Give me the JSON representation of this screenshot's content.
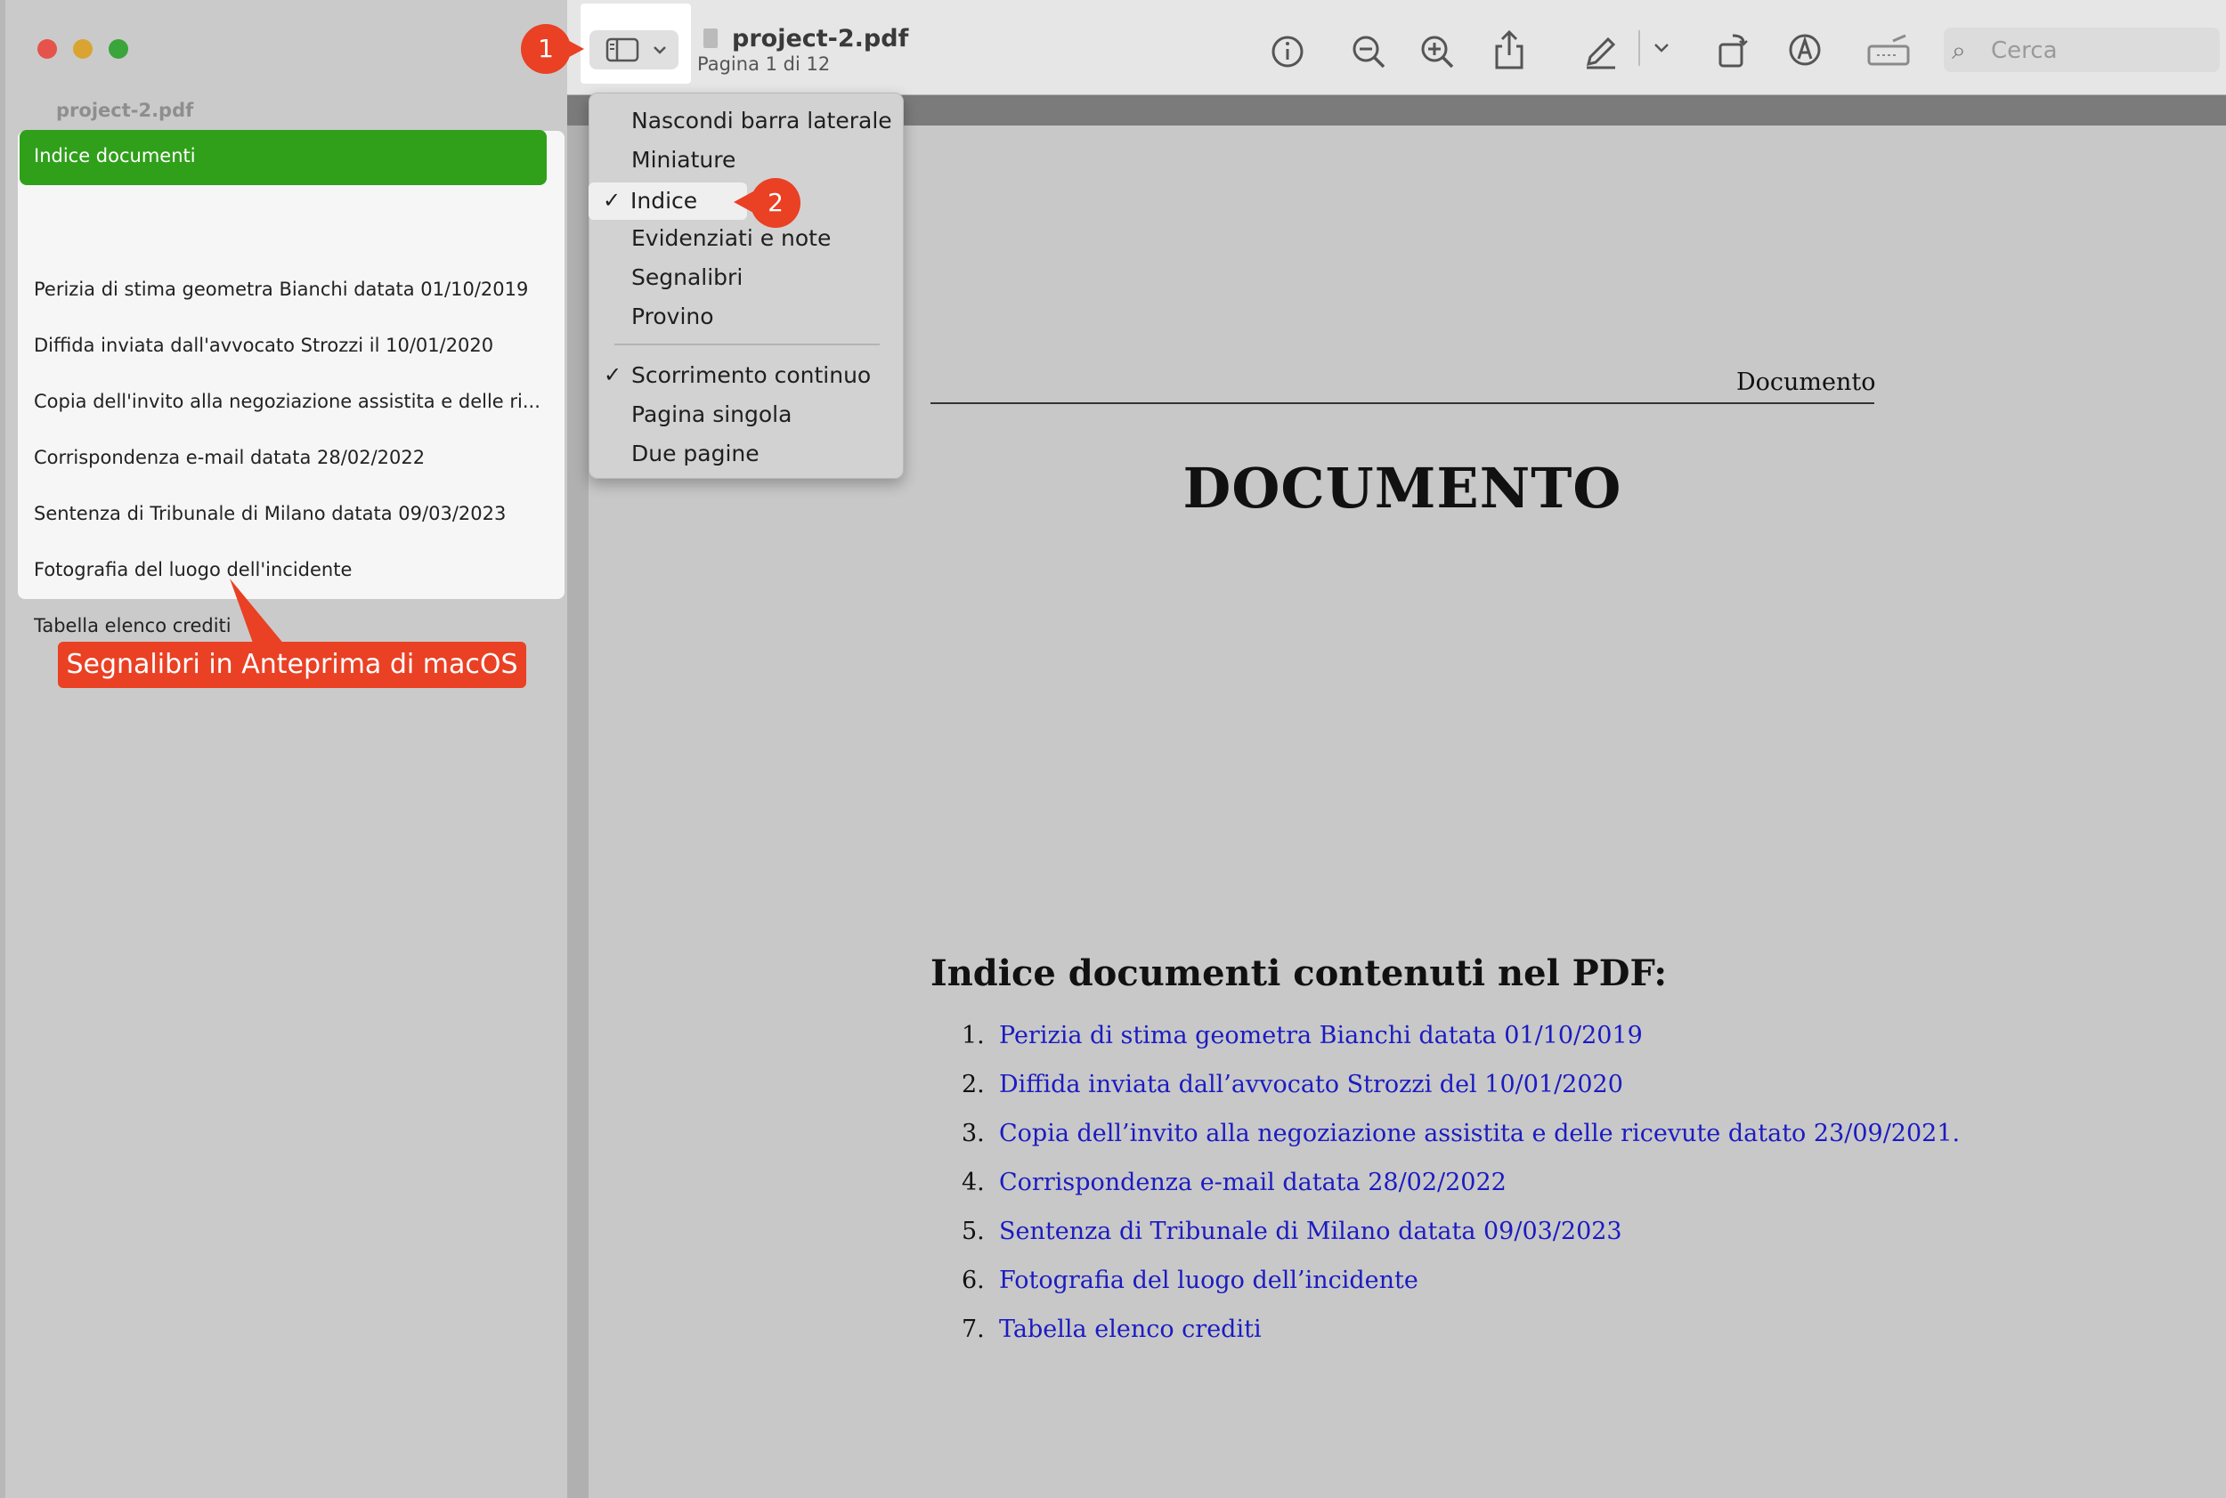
{
  "window": {
    "title": "project-2.pdf",
    "subtitle": "Pagina 1 di 12"
  },
  "sidebar": {
    "file_name": "project-2.pdf",
    "items": [
      "Indice documenti",
      "Perizia di stima geometra Bianchi datata 01/10/2019",
      "Diffida inviata dall'avvocato Strozzi il 10/01/2020",
      "Copia dell'invito alla negoziazione assistita e delle ri...",
      "Corrispondenza e-mail datata 28/02/2022",
      "Sentenza di Tribunale di Milano datata 09/03/2023",
      "Fotografia del luogo dell'incidente",
      "Tabella elenco crediti"
    ],
    "selected_color": "#30a01a"
  },
  "callout": {
    "text": "Segnalibri in Anteprima di macOS",
    "color": "#ea4024"
  },
  "badges": [
    "1",
    "2"
  ],
  "menu": {
    "items": [
      "Nascondi barra laterale",
      "Miniature",
      "Indice",
      "Evidenziati e note",
      "Segnalibri",
      "Provino",
      "Scorrimento continuo",
      "Pagina singola",
      "Due pagine"
    ],
    "check": "✓"
  },
  "search": {
    "placeholder": "Cerca"
  },
  "icons": {
    "info": "info-icon",
    "zoom_out": "zoom-out-icon",
    "zoom_in": "zoom-in-icon",
    "share": "share-icon",
    "markup": "pencil-icon",
    "rotate": "rotate-icon",
    "annotate": "markup-icon",
    "sign": "signature-icon"
  },
  "document": {
    "header": "Documento",
    "title": "DOCUMENTO",
    "index_title": "Indice documenti contenuti nel PDF:",
    "items": [
      {
        "num": "1.",
        "text": "Perizia di stima geometra Bianchi datata 01/10/2019"
      },
      {
        "num": "2.",
        "text": "Diffida inviata dall’avvocato Strozzi del 10/01/2020"
      },
      {
        "num": "3.",
        "text": "Copia dell’invito alla negoziazione assistita e delle ricevute datato 23/09/2021."
      },
      {
        "num": "4.",
        "text": "Corrispondenza e-mail datata 28/02/2022"
      },
      {
        "num": "5.",
        "text": "Sentenza di Tribunale di Milano datata 09/03/2023"
      },
      {
        "num": "6.",
        "text": "Fotografia del luogo dell’incidente"
      },
      {
        "num": "7.",
        "text": "Tabella elenco crediti"
      }
    ],
    "link_color": "#1b1bc2"
  }
}
